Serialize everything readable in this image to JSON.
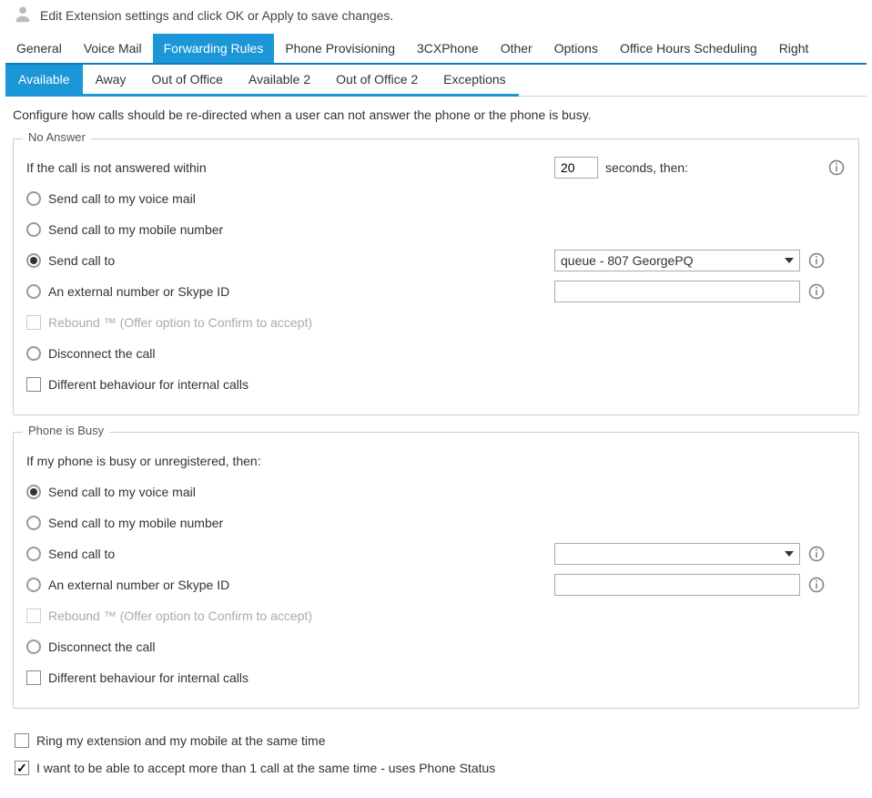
{
  "header": {
    "text": "Edit Extension settings and click OK or Apply to save changes."
  },
  "main_tabs": [
    "General",
    "Voice Mail",
    "Forwarding Rules",
    "Phone Provisioning",
    "3CXPhone",
    "Other",
    "Options",
    "Office Hours Scheduling",
    "Right"
  ],
  "main_tab_active": 2,
  "sub_tabs": [
    "Available",
    "Away",
    "Out of Office",
    "Available 2",
    "Out of Office 2",
    "Exceptions"
  ],
  "sub_tab_active": 0,
  "intro": "Configure how calls should be re-directed when a user can not answer the phone or the phone is busy.",
  "no_answer": {
    "legend": "No Answer",
    "prompt_pre": "If the call is not answered within",
    "seconds_value": "20",
    "prompt_post": "seconds, then:",
    "options": {
      "voicemail": "Send call to my voice mail",
      "mobile": "Send call to my mobile number",
      "sendto": "Send call to",
      "external": "An external number or Skype ID",
      "rebound": "Rebound ™ (Offer option to Confirm to accept)",
      "disconnect": "Disconnect the call",
      "diff_internal": "Different behaviour for internal calls"
    },
    "selected": "sendto",
    "sendto_value": "queue - 807 GeorgePQ",
    "external_value": ""
  },
  "busy": {
    "legend": "Phone is Busy",
    "prompt": "If my phone is busy or unregistered, then:",
    "options": {
      "voicemail": "Send call to my voice mail",
      "mobile": "Send call to my mobile number",
      "sendto": "Send call to",
      "external": "An external number or Skype ID",
      "rebound": "Rebound ™ (Offer option to Confirm to accept)",
      "disconnect": "Disconnect the call",
      "diff_internal": "Different behaviour for internal calls"
    },
    "selected": "voicemail",
    "sendto_value": "",
    "external_value": ""
  },
  "bottom": {
    "ring_both": {
      "label": "Ring my extension and my mobile at the same time",
      "checked": false
    },
    "multi_call": {
      "label": "I want to be able to accept more than 1 call at the same time - uses Phone Status",
      "checked": true
    }
  }
}
